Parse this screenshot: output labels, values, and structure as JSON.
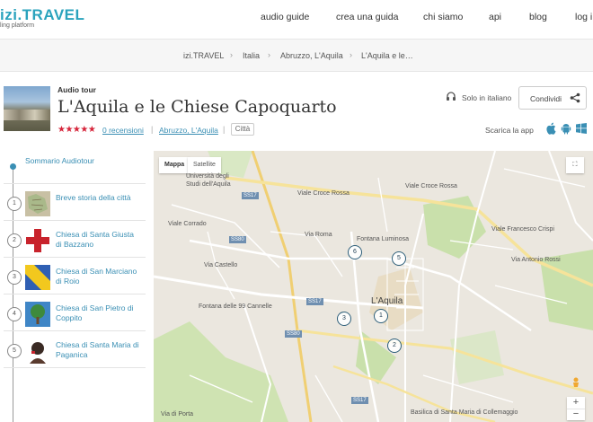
{
  "nav": {
    "logo": "izi.TRAVEL",
    "logo_sub": "ling platform",
    "items": [
      "audio guide",
      "crea una guida",
      "chi siamo",
      "api",
      "blog",
      "log i"
    ]
  },
  "breadcrumbs": [
    "izi.TRAVEL",
    "Italia",
    "Abruzzo, L'Aquila",
    "L'Aquila e le…"
  ],
  "tour": {
    "kicker": "Audio tour",
    "title": "L'Aquila e le Chiese Capoquarto",
    "stars": "★★★★★",
    "reviews": "0 recensioni",
    "location": "Abruzzo, L'Aquila",
    "tag": "Città",
    "language": "Solo in italiano",
    "share_label": "Condividi",
    "download_label": "Scarica la app"
  },
  "sidebar": {
    "summary_label": "Sommario Audiotour",
    "stops": [
      {
        "num": "1",
        "label": "Breve storia della città"
      },
      {
        "num": "2",
        "label": "Chiesa di Santa Giusta di Bazzano"
      },
      {
        "num": "3",
        "label": "Chiesa di San Marciano di Roio"
      },
      {
        "num": "4",
        "label": "Chiesa di San Pietro di Coppito"
      },
      {
        "num": "5",
        "label": "Chiesa di Santa Maria di Paganica"
      }
    ]
  },
  "map": {
    "btn_map": "Mappa",
    "btn_satellite": "Satellite",
    "labels": {
      "uni": "Università degli Studi dell'Aquila",
      "croce_rossa": "Viale Croce Rossa",
      "croce_rossa2": "Viale Croce Rossa",
      "fontana_luminosa": "Fontana Luminosa",
      "aquila": "L'Aquila",
      "fontana99": "Fontana delle 99 Cannelle",
      "via_roma": "Via Roma",
      "basilica": "Basilica di Santa Maria di Collemaggio",
      "via_porta": "Via di Porta",
      "viale_crispi": "Viale Francesco Crispi",
      "via_antonio": "Via Antonio Rossi",
      "viale_corrado": "Viale Corrado",
      "via_castello": "Via Castello"
    },
    "road_ids": [
      "SS17",
      "SS80",
      "SS17",
      "SS80",
      "SS17"
    ],
    "pins": [
      "6",
      "5",
      "1",
      "2",
      "3"
    ]
  }
}
